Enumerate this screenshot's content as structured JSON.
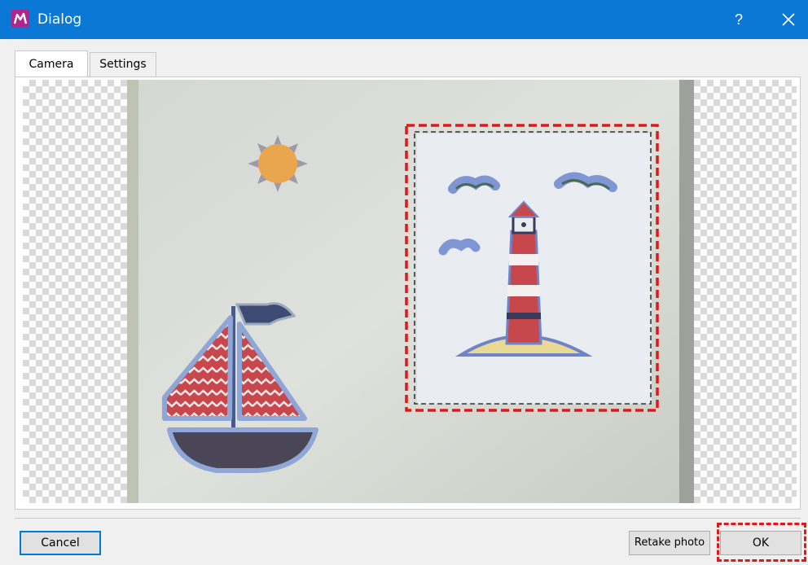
{
  "window": {
    "title": "Dialog",
    "help_label": "?",
    "app_icon": "app-logo-icon",
    "close_icon": "close-icon"
  },
  "tabs": [
    {
      "label": "Camera",
      "active": true
    },
    {
      "label": "Settings",
      "active": false
    }
  ],
  "camera": {
    "selection_active": true
  },
  "buttons": {
    "cancel": "Cancel",
    "retake": "Retake photo",
    "ok": "OK"
  },
  "colors": {
    "titlebar": "#0a78d4",
    "selection_border": "#e01818",
    "focus_border": "#0078d7"
  }
}
